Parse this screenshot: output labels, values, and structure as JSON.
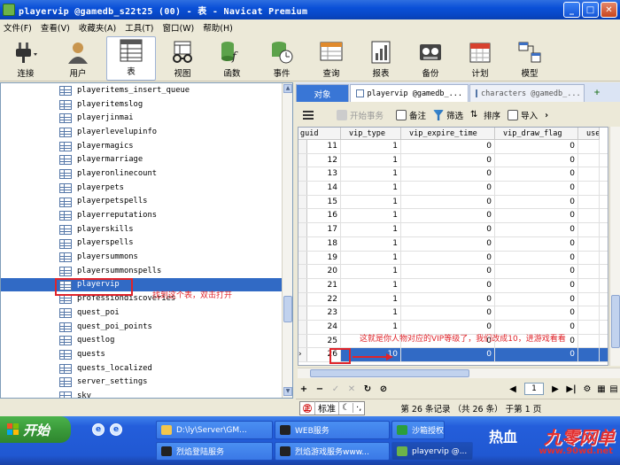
{
  "window": {
    "title": "playervip @gamedb_s22t25 (00) - 表 - Navicat Premium"
  },
  "menu": [
    "文件(F)",
    "查看(V)",
    "收藏夹(A)",
    "工具(T)",
    "窗口(W)",
    "帮助(H)"
  ],
  "toolbar": {
    "connect": "连接",
    "user": "用户",
    "table": "表",
    "view": "视图",
    "function": "函数",
    "event": "事件",
    "query": "查询",
    "report": "报表",
    "backup": "备份",
    "schedule": "计划",
    "model": "模型"
  },
  "tree": {
    "items": [
      "playeritems_insert_queue",
      "playeritemslog",
      "playerjinmai",
      "playerlevelupinfo",
      "playermagics",
      "playermarriage",
      "playeronlinecount",
      "playerpets",
      "playerpetspells",
      "playerreputations",
      "playerskills",
      "playerspells",
      "playersummons",
      "playersummonspells",
      "playervip",
      "professiondiscoveries",
      "quest_poi",
      "quest_poi_points",
      "questlog",
      "quests",
      "quests_localized",
      "server_settings",
      "sky"
    ],
    "selected_index": 14
  },
  "annotations": {
    "find_table": "找到这个表，双击打开",
    "vip_note": "这就是你人物对应的VIP等级了，我们改成10，进游戏看看"
  },
  "tabs": {
    "objects": "对象",
    "active": "playervip @gamedb_...",
    "other": "characters @gamedb_..."
  },
  "grid_toolbar": {
    "begin_transaction": "开始事务",
    "memo": "备注",
    "filter": "筛选",
    "sort": "排序",
    "import": "导入"
  },
  "grid": {
    "columns": [
      "guid",
      "vip_type",
      "vip_expire_time",
      "vip_draw_flag",
      "usec"
    ],
    "rows": [
      [
        "11",
        "1",
        "0",
        "0"
      ],
      [
        "12",
        "1",
        "0",
        "0"
      ],
      [
        "13",
        "1",
        "0",
        "0"
      ],
      [
        "14",
        "1",
        "0",
        "0"
      ],
      [
        "15",
        "1",
        "0",
        "0"
      ],
      [
        "16",
        "1",
        "0",
        "0"
      ],
      [
        "17",
        "1",
        "0",
        "0"
      ],
      [
        "18",
        "1",
        "0",
        "0"
      ],
      [
        "19",
        "1",
        "0",
        "0"
      ],
      [
        "20",
        "1",
        "0",
        "0"
      ],
      [
        "21",
        "1",
        "0",
        "0"
      ],
      [
        "22",
        "1",
        "0",
        "0"
      ],
      [
        "23",
        "1",
        "0",
        "0"
      ],
      [
        "24",
        "1",
        "0",
        "0"
      ],
      [
        "25",
        "",
        "0",
        "0"
      ],
      [
        "26",
        "10",
        "0",
        "0"
      ]
    ],
    "selected_row": 15
  },
  "navbar": {
    "page": "1"
  },
  "status": {
    "ime": "标准",
    "records": "第 26 条记录 （共 26 条） 于第 1 页"
  },
  "taskbar": {
    "start": "开始",
    "tasks": [
      "D:\\ly\\Server\\GM...",
      "WEB服务",
      "沙箱授权",
      "烈焰登陆服务",
      "烈焰游戏服务www...",
      "playervip @..."
    ]
  },
  "watermark": {
    "hot": "热血",
    "logo": "九零网单",
    "url": "www.90wd.net"
  }
}
